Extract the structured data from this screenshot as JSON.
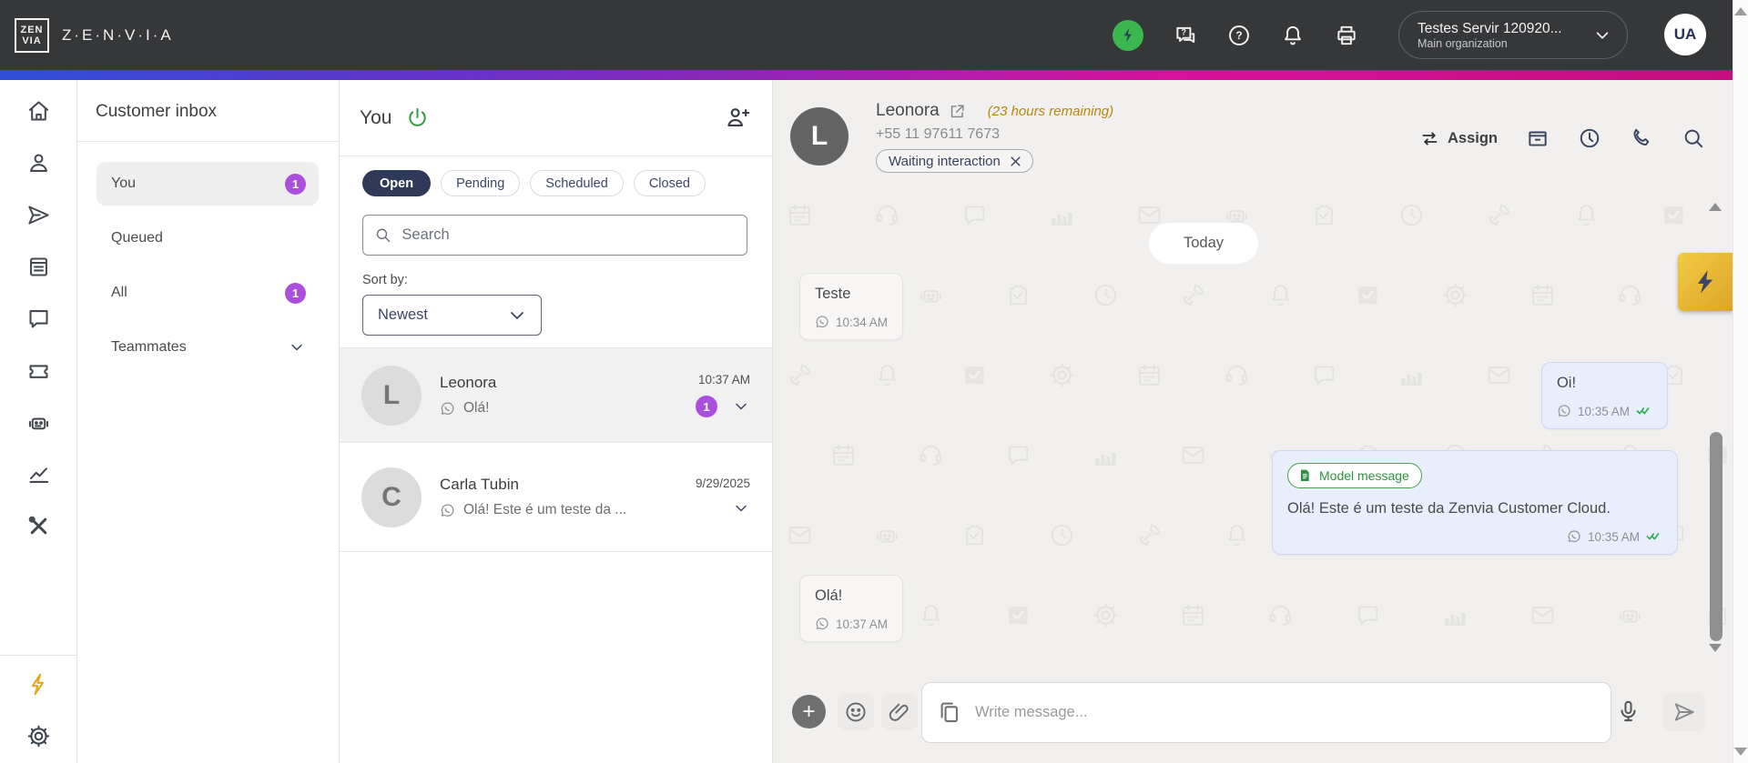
{
  "topbar": {
    "logo_lines": [
      "ZEN",
      "VIA"
    ],
    "brand": "Z·E·N·V·I·A",
    "org": {
      "name": "Testes Servir 120920...",
      "sub": "Main organization"
    },
    "avatar_initials": "UA"
  },
  "inbox_panel": {
    "title": "Customer inbox",
    "items": [
      {
        "label": "You",
        "badge": "1"
      },
      {
        "label": "Queued",
        "badge": ""
      },
      {
        "label": "All",
        "badge": "1"
      },
      {
        "label": "Teammates",
        "badge": ""
      }
    ]
  },
  "list_panel": {
    "title": "You",
    "tabs": [
      {
        "label": "Open"
      },
      {
        "label": "Pending"
      },
      {
        "label": "Scheduled"
      },
      {
        "label": "Closed"
      }
    ],
    "search_placeholder": "Search",
    "sort_label": "Sort by:",
    "sort_value": "Newest",
    "conversations": [
      {
        "initial": "L",
        "name": "Leonora",
        "preview": "Olá!",
        "time": "10:37 AM",
        "badge": "1"
      },
      {
        "initial": "C",
        "name": "Carla Tubin",
        "preview": "Olá! Este é um teste da ...",
        "time": "9/29/2025",
        "badge": ""
      }
    ]
  },
  "chat": {
    "header": {
      "initial": "L",
      "name": "Leonora",
      "remaining": "(23 hours remaining)",
      "phone": "+55 11 97611 7673",
      "tag": "Waiting interaction",
      "assign_label": "Assign"
    },
    "date_divider": "Today",
    "messages": [
      {
        "direction": "in",
        "text": "Teste",
        "time": "10:34 AM"
      },
      {
        "direction": "out",
        "text": "Oi!",
        "time": "10:35 AM"
      },
      {
        "direction": "out",
        "badge": "Model message",
        "text": "Olá! Este é um teste da Zenvia Customer Cloud.",
        "time": "10:35 AM"
      },
      {
        "direction": "in",
        "text": "Olá!",
        "time": "10:37 AM"
      }
    ],
    "composer_placeholder": "Write message..."
  },
  "colors": {
    "topbar_bg": "#363739",
    "gradient": [
      "#2e4fd8",
      "#8c27b8",
      "#d9119b",
      "#c40e7e"
    ],
    "badge_purple": "#aa4fdc",
    "active_tab_navy": "#2e3a57",
    "power_green": "#2e9e43",
    "assistant_green": "#3cb64f",
    "remaining_amber": "#b8860b",
    "outgoing_bubble": "#e9eefc",
    "quick_button_amber": "#eec13a",
    "check_green": "#2fae4e"
  }
}
